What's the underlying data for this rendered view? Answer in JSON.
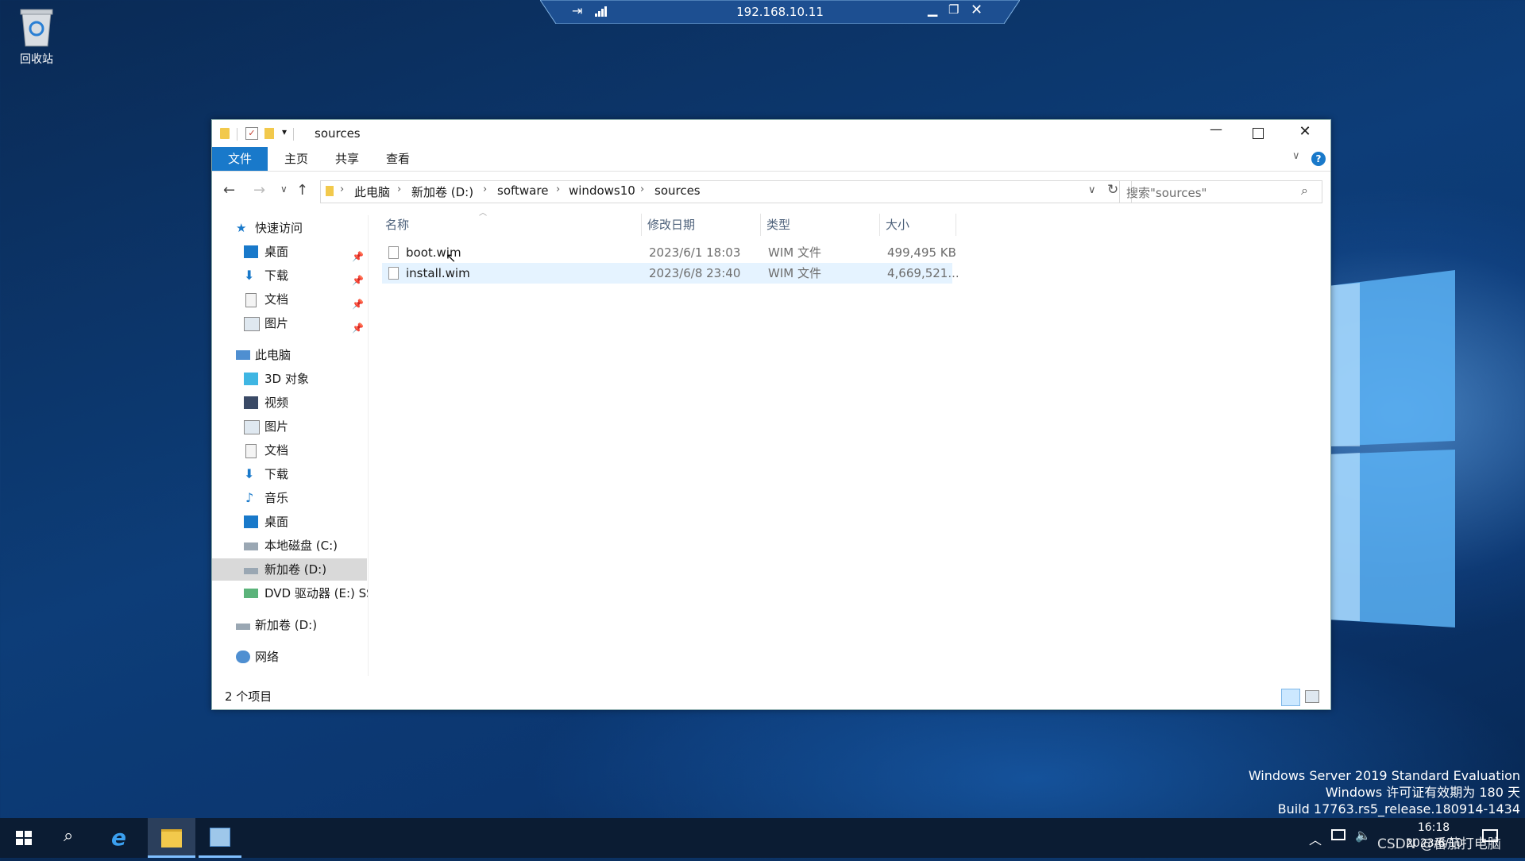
{
  "desktop": {
    "recycle_bin_label": "回收站",
    "watermark_lines": [
      "Windows Server 2019 Standard Evaluation",
      "Windows 许可证有效期为 180 天",
      "Build 17763.rs5_release.180914-1434"
    ]
  },
  "rdp_bar": {
    "ip": "192.168.10.11"
  },
  "explorer": {
    "title": "sources",
    "ribbon_tabs": [
      "文件",
      "主页",
      "共享",
      "查看"
    ],
    "breadcrumb": [
      "此电脑",
      "新加卷 (D:)",
      "software",
      "windows10",
      "sources"
    ],
    "search_placeholder": "搜索\"sources\"",
    "nav": {
      "quick_access": "快速访问",
      "quick_items": [
        "桌面",
        "下载",
        "文档",
        "图片"
      ],
      "this_pc": "此电脑",
      "pc_items": [
        "3D 对象",
        "视频",
        "图片",
        "文档",
        "下载",
        "音乐",
        "桌面",
        "本地磁盘 (C:)",
        "新加卷 (D:)",
        "DVD 驱动器 (E:) SS"
      ],
      "drive_d": "新加卷 (D:)",
      "network": "网络"
    },
    "columns": [
      "名称",
      "修改日期",
      "类型",
      "大小"
    ],
    "files": [
      {
        "name": "boot.wim",
        "date": "2023/6/1 18:03",
        "type": "WIM 文件",
        "size": "499,495 KB"
      },
      {
        "name": "install.wim",
        "date": "2023/6/8 23:40",
        "type": "WIM 文件",
        "size": "4,669,521..."
      }
    ],
    "status": "2 个项目"
  },
  "taskbar": {
    "clock_time": "16:18",
    "clock_date": "2023/6/10",
    "overlay_text": "CSDN @番茄打电脑"
  },
  "colors": {
    "accent": "#1979ca",
    "selection": "#cce8ff",
    "taskbar": "#0b1c33"
  }
}
